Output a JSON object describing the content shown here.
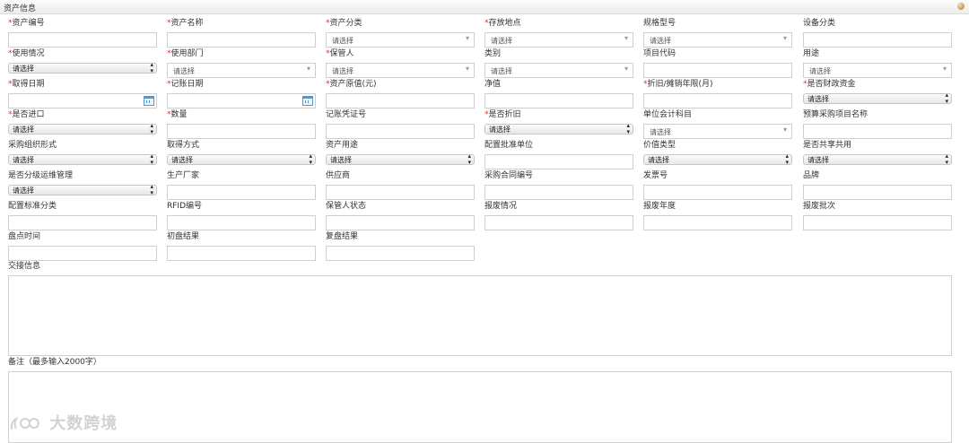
{
  "section_title": "资产信息",
  "required_mark": "*",
  "fields": {
    "asset_no": {
      "label": "资产编号",
      "required": true
    },
    "asset_name": {
      "label": "资产名称",
      "required": true
    },
    "asset_category": {
      "label": "资产分类",
      "required": true,
      "value": "请选择"
    },
    "storage_location": {
      "label": "存放地点",
      "required": true,
      "value": "请选择"
    },
    "spec_model": {
      "label": "规格型号",
      "value": "请选择"
    },
    "device_category": {
      "label": "设备分类"
    },
    "usage_status": {
      "label": "使用情况",
      "required": true,
      "value": "请选择"
    },
    "using_dept": {
      "label": "使用部门",
      "required": true,
      "value": "请选择"
    },
    "custodian": {
      "label": "保管人",
      "required": true,
      "value": "请选择"
    },
    "type": {
      "label": "类别",
      "value": "请选择"
    },
    "project_code": {
      "label": "项目代码"
    },
    "purpose": {
      "label": "用途",
      "value": "请选择"
    },
    "acquire_date": {
      "label": "取得日期",
      "required": true
    },
    "booking_date": {
      "label": "记账日期",
      "required": true
    },
    "original_value": {
      "label": "资产原值(元)",
      "required": true
    },
    "net_value": {
      "label": "净值"
    },
    "depreciation_years": {
      "label": "折旧/摊销年限(月)",
      "required": true
    },
    "fiscal_fund": {
      "label": "是否财政资金",
      "required": true,
      "value": "请选择"
    },
    "is_imported": {
      "label": "是否进口",
      "required": true,
      "value": "请选择"
    },
    "quantity": {
      "label": "数量",
      "required": true
    },
    "voucher_no": {
      "label": "记账凭证号"
    },
    "is_depreciated": {
      "label": "是否折旧",
      "required": true,
      "value": "请选择"
    },
    "unit_account": {
      "label": "单位会计科目",
      "value": "请选择"
    },
    "budget_project": {
      "label": "预算采购项目名称"
    },
    "procurement_form": {
      "label": "采购组织形式",
      "value": "请选择"
    },
    "acquire_method": {
      "label": "取得方式",
      "value": "请选择"
    },
    "asset_use": {
      "label": "资产用途",
      "value": "请选择"
    },
    "approval_unit": {
      "label": "配置批准单位"
    },
    "value_type": {
      "label": "价值类型",
      "value": "请选择"
    },
    "is_shared": {
      "label": "是否共享共用",
      "value": "请选择"
    },
    "tiered_maintenance": {
      "label": "是否分级运维管理",
      "value": "请选择"
    },
    "manufacturer": {
      "label": "生产厂家"
    },
    "supplier": {
      "label": "供应商"
    },
    "contract_no": {
      "label": "采购合同编号"
    },
    "invoice_no": {
      "label": "发票号"
    },
    "brand": {
      "label": "品牌"
    },
    "config_standard": {
      "label": "配置标准分类"
    },
    "rfid": {
      "label": "RFID编号"
    },
    "custodian_status": {
      "label": "保管人状态"
    },
    "scrap_status": {
      "label": "报废情况"
    },
    "scrap_year": {
      "label": "报废年度"
    },
    "scrap_batch": {
      "label": "报废批次"
    },
    "inventory_time": {
      "label": "盘点时间"
    },
    "initial_result": {
      "label": "初盘结果"
    },
    "recheck_result": {
      "label": "复盘结果"
    }
  },
  "handover": {
    "label": "交接信息"
  },
  "remarks": {
    "label": "备注（最多输入2000字）"
  },
  "watermark": "大数跨境"
}
